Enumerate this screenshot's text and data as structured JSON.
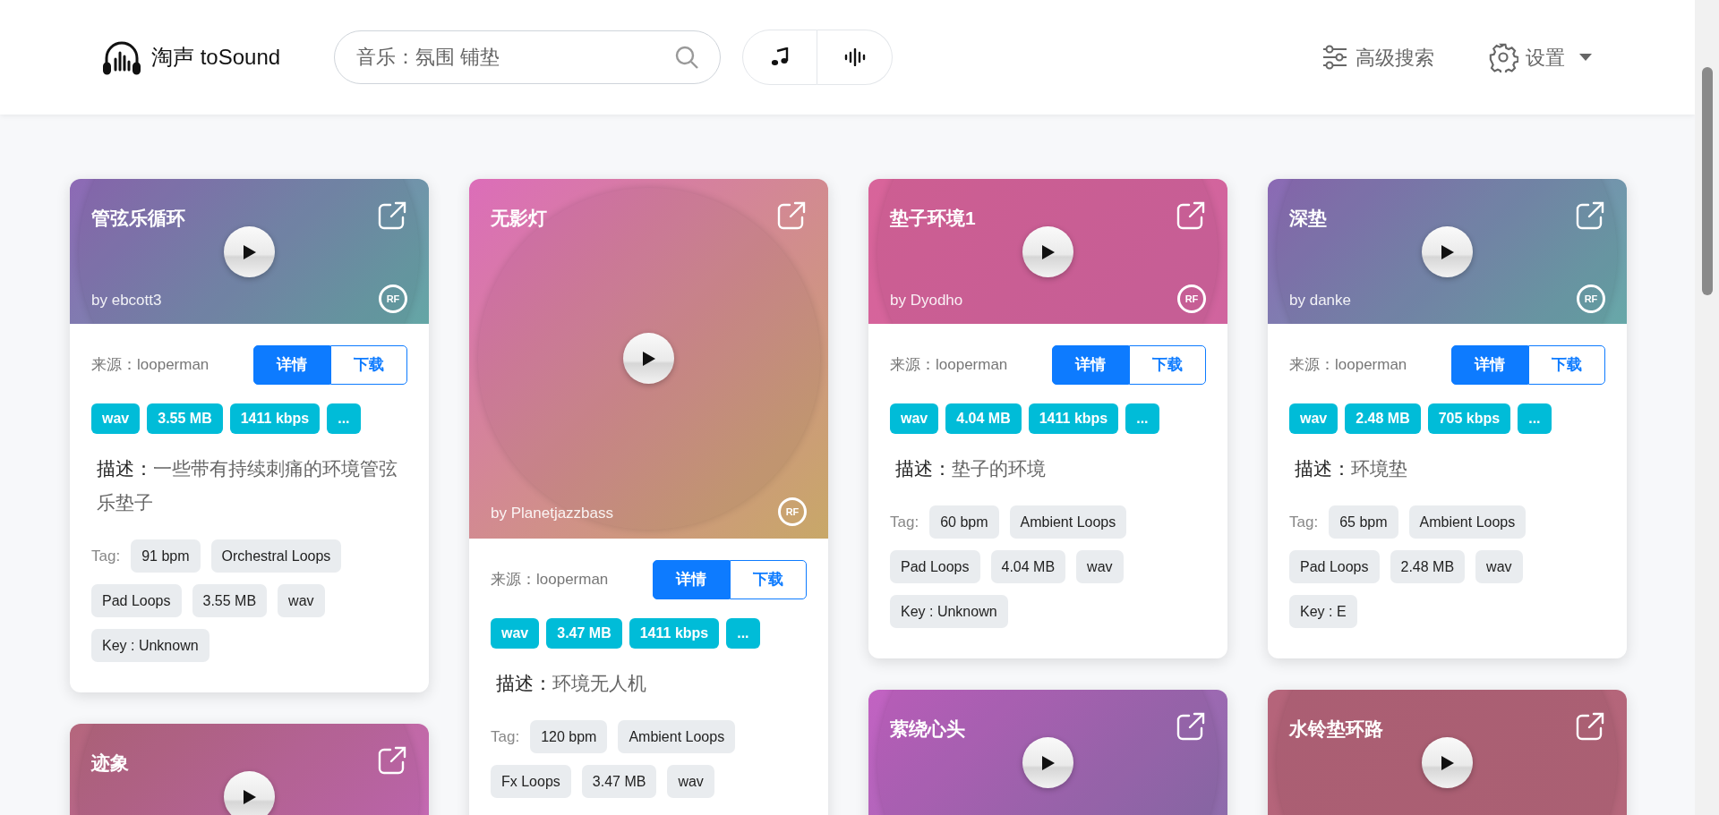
{
  "header": {
    "logo": "淘声 toSound",
    "search": {
      "placeholder": "音乐：氛围 铺垫"
    },
    "modes": [
      {
        "kind": "music"
      },
      {
        "kind": "wave"
      }
    ],
    "links": [
      {
        "kind": "sliders",
        "label": "高级搜索",
        "caret": false
      },
      {
        "kind": "gear",
        "label": "设置",
        "caret": true
      }
    ]
  },
  "columns": [
    {
      "cards": [
        {
          "title": "管弦乐循环",
          "kind": "short",
          "color": "#8d69b5",
          "gradient_end": {
            "color": "#64a6a5"
          },
          "author": "by ebcott3",
          "license": "RF",
          "source": "来源：looperman",
          "actions": [
            {
              "label": "详情",
              "kind": "primary"
            },
            {
              "label": "下载",
              "kind": "outline"
            }
          ],
          "badges": [
            "wav",
            "3.55 MB",
            "1411 kbps",
            "..."
          ],
          "description_label": "描述：",
          "description": "一些带有持续刺痛的环境管弦乐垫子",
          "tag_label": "Tag:",
          "tags": [
            "91 bpm",
            "Orchestral Loops",
            "Pad Loops",
            "3.55 MB",
            "wav",
            "Key : Unknown"
          ]
        },
        {
          "title": "迹象",
          "kind": "short",
          "color": "#b4667c",
          "gradient_end": {
            "color": "#c66ab9"
          }
        }
      ]
    },
    {
      "cards": [
        {
          "title": "无影灯",
          "kind": "tall",
          "color": "#dc6db9",
          "gradient_end": {
            "color": "#c8a868"
          },
          "author": "by Planetjazzbass",
          "license": "RF",
          "source": "来源：looperman",
          "actions": [
            {
              "label": "详情",
              "kind": "primary"
            },
            {
              "label": "下载",
              "kind": "outline"
            }
          ],
          "badges": [
            "wav",
            "3.47 MB",
            "1411 kbps",
            "..."
          ],
          "description_label": "描述：",
          "description": "环境无人机",
          "tag_label": "Tag:",
          "tags": [
            "120 bpm",
            "Ambient Loops",
            "Fx Loops",
            "3.47 MB",
            "wav"
          ]
        }
      ]
    },
    {
      "cards": [
        {
          "title": "垫子环境1",
          "kind": "short",
          "color": "#d8649a",
          "gradient_end": {
            "color": "#d0649e"
          },
          "author": "by Dyodho",
          "license": "RF",
          "source": "来源：looperman",
          "actions": [
            {
              "label": "详情",
              "kind": "primary"
            },
            {
              "label": "下载",
              "kind": "outline"
            }
          ],
          "badges": [
            "wav",
            "4.04 MB",
            "1411 kbps",
            "..."
          ],
          "description_label": "描述：",
          "description": "垫子的环境",
          "tag_label": "Tag:",
          "tags": [
            "60 bpm",
            "Ambient Loops",
            "Pad Loops",
            "4.04 MB",
            "wav",
            "Key : Unknown"
          ]
        },
        {
          "title": "萦绕心头",
          "kind": "short",
          "color": "#c262c2",
          "gradient_end": {
            "color": "#8b6caa"
          }
        }
      ]
    },
    {
      "cards": [
        {
          "title": "深垫",
          "kind": "short",
          "color": "#8b69b4",
          "gradient_end": {
            "color": "#67a8a8"
          },
          "author": "by danke",
          "license": "RF",
          "source": "来源：looperman",
          "actions": [
            {
              "label": "详情",
              "kind": "primary"
            },
            {
              "label": "下载",
              "kind": "outline"
            }
          ],
          "badges": [
            "wav",
            "2.48 MB",
            "705 kbps",
            "..."
          ],
          "description_label": "描述：",
          "description": "环境垫",
          "tag_label": "Tag:",
          "tags": [
            "65 bpm",
            "Ambient Loops",
            "Pad Loops",
            "2.48 MB",
            "wav",
            "Key : E"
          ]
        },
        {
          "title": "水铃垫环路",
          "kind": "short",
          "color": "#b5647a",
          "gradient_end": {
            "color": "#b4667a"
          }
        }
      ]
    }
  ]
}
